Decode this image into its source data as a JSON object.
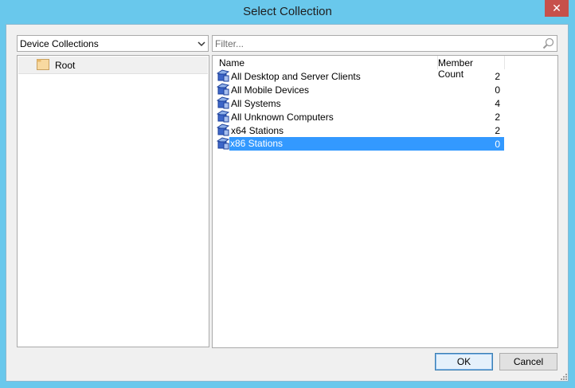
{
  "window": {
    "title": "Select Collection",
    "close_symbol": "✕"
  },
  "left_panel": {
    "collection_type": "Device Collections",
    "tree_items": [
      {
        "label": "Root",
        "icon": "folder-icon"
      }
    ]
  },
  "right_panel": {
    "filter_placeholder": "Filter...",
    "columns": {
      "name": "Name",
      "member_count": "Member Count"
    },
    "rows": [
      {
        "name": "All Desktop and Server Clients",
        "count": "2",
        "selected": false
      },
      {
        "name": "All Mobile Devices",
        "count": "0",
        "selected": false
      },
      {
        "name": "All Systems",
        "count": "4",
        "selected": false
      },
      {
        "name": "All Unknown Computers",
        "count": "2",
        "selected": false
      },
      {
        "name": "x64 Stations",
        "count": "2",
        "selected": false
      },
      {
        "name": "x86 Stations",
        "count": "0",
        "selected": true
      }
    ]
  },
  "buttons": {
    "ok": "OK",
    "cancel": "Cancel"
  },
  "colors": {
    "titlebar": "#69c8ec",
    "close": "#c7504b",
    "selection": "#3399ff"
  }
}
